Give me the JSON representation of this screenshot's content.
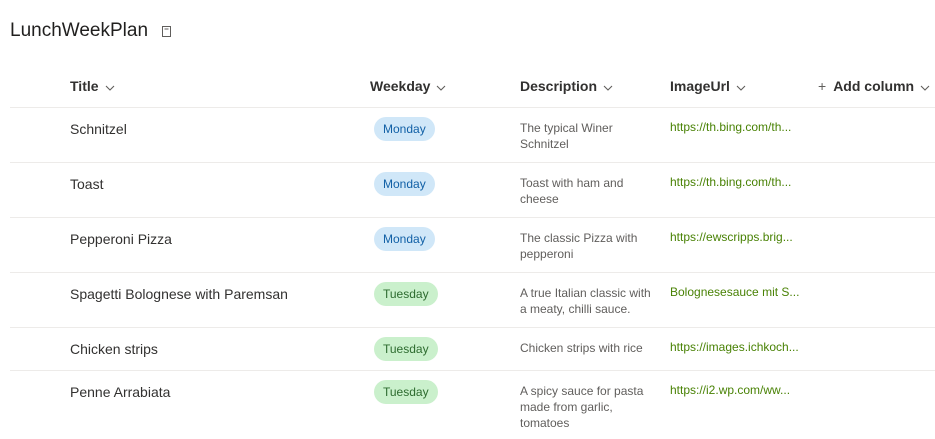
{
  "page": {
    "title": "LunchWeekPlan"
  },
  "columns": {
    "title": "Title",
    "weekday": "Weekday",
    "description": "Description",
    "imageurl": "ImageUrl",
    "add_column": "Add column"
  },
  "colors": {
    "monday_pill": "#d0e7f8",
    "tuesday_pill": "#caf0cc",
    "link": "#498205"
  },
  "rows": [
    {
      "title": "Schnitzel",
      "weekday": "Monday",
      "description": "The typical Winer Schnitzel",
      "imageurl": "https://th.bing.com/th..."
    },
    {
      "title": "Toast",
      "weekday": "Monday",
      "description": "Toast with ham and cheese",
      "imageurl": "https://th.bing.com/th..."
    },
    {
      "title": "Pepperoni Pizza",
      "weekday": "Monday",
      "description": "The classic Pizza with pepperoni",
      "imageurl": "https://ewscripps.brig..."
    },
    {
      "title": "Spagetti Bolognese with Paremsan",
      "weekday": "Tuesday",
      "description": "A true Italian classic with a meaty, chilli sauce.",
      "imageurl": "Bolognesesauce mit S..."
    },
    {
      "title": "Chicken strips",
      "weekday": "Tuesday",
      "description": "Chicken strips with rice",
      "imageurl": "https://images.ichkoch..."
    },
    {
      "title": "Penne Arrabiata",
      "weekday": "Tuesday",
      "description": "A spicy sauce for pasta made from garlic, tomatoes",
      "imageurl": "https://i2.wp.com/ww..."
    }
  ]
}
